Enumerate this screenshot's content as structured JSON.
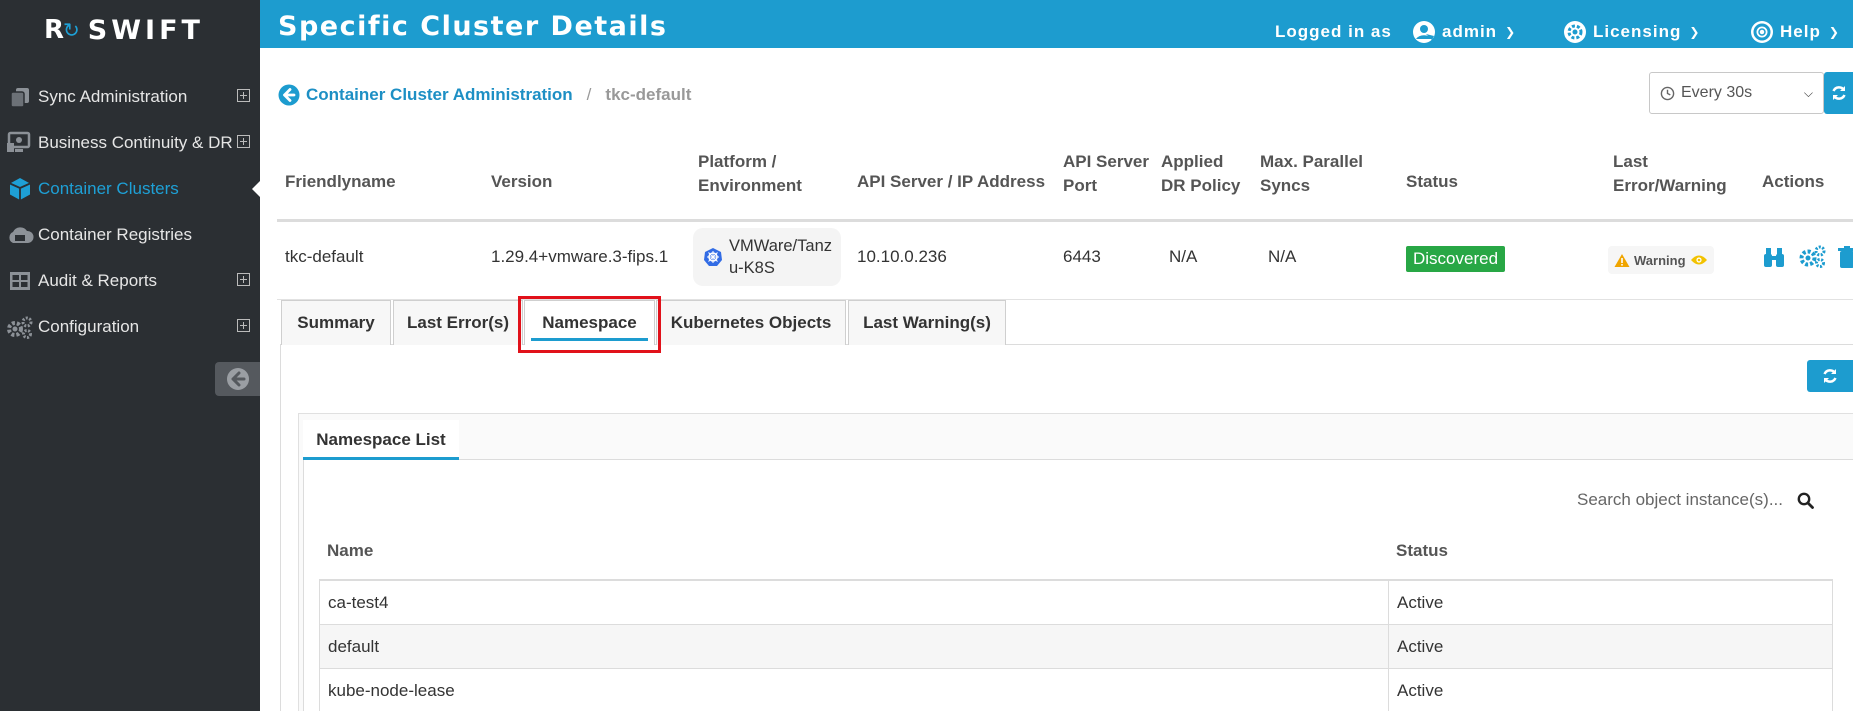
{
  "brand": {
    "logo_mark": "R",
    "logo_word": "SWIFT",
    "accent": "#1d9ccf"
  },
  "sidebar": {
    "items": [
      {
        "label": "Sync Administration",
        "icon": "copy-icon",
        "expandable": true
      },
      {
        "label": "Business Continuity & DR",
        "icon": "dr-icon",
        "expandable": true
      },
      {
        "label": "Container Clusters",
        "icon": "cube-icon",
        "active": true
      },
      {
        "label": "Container Registries",
        "icon": "cloud-icon"
      },
      {
        "label": "Audit & Reports",
        "icon": "grid-icon",
        "expandable": true
      },
      {
        "label": "Configuration",
        "icon": "gears-icon",
        "expandable": true
      }
    ]
  },
  "header": {
    "title": "Specific Cluster Details",
    "logged_in_label": "Logged in as",
    "user": "admin",
    "licensing": "Licensing",
    "help": "Help"
  },
  "breadcrumb": {
    "parent": "Container Cluster Administration",
    "separator": "/",
    "current": "tkc-default"
  },
  "refresh": {
    "interval": "Every 30s"
  },
  "cluster_table": {
    "headers": {
      "friendlyname": "Friendlyname",
      "version": "Version",
      "platform_1": "Platform /",
      "platform_2": "Environment",
      "api_server": "API Server / IP Address",
      "port_1": "API Server",
      "port_2": "Port",
      "policy_1": "Applied",
      "policy_2": "DR Policy",
      "syncs_1": "Max. Parallel",
      "syncs_2": "Syncs",
      "status": "Status",
      "last_1": "Last",
      "last_2": "Error/Warning",
      "actions": "Actions"
    },
    "row": {
      "friendlyname": "tkc-default",
      "version": "1.29.4+vmware.3-fips.1",
      "platform_1": "VMWare/Tanz",
      "platform_2": "u-K8S",
      "api_server": "10.10.0.236",
      "port": "6443",
      "policy": "N/A",
      "syncs": "N/A",
      "status": "Discovered",
      "status_color": "#28a745",
      "warning": "Warning"
    }
  },
  "tabs": [
    {
      "label": "Summary"
    },
    {
      "label": "Last Error(s)"
    },
    {
      "label": "Namespace",
      "active": true
    },
    {
      "label": "Kubernetes Objects"
    },
    {
      "label": "Last Warning(s)"
    }
  ],
  "namespace": {
    "card_tab": "Namespace List",
    "search_placeholder": "Search object instance(s)...",
    "columns": {
      "name": "Name",
      "status": "Status"
    },
    "rows": [
      {
        "name": "ca-test4",
        "status": "Active"
      },
      {
        "name": "default",
        "status": "Active"
      },
      {
        "name": "kube-node-lease",
        "status": "Active"
      }
    ]
  }
}
